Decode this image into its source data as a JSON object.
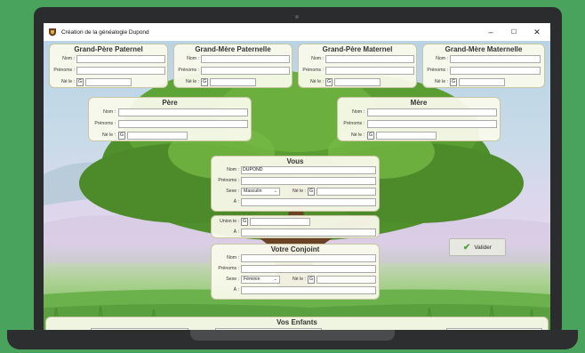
{
  "window": {
    "title": "Création de la généalogie Dupond",
    "controls": {
      "minimize": "–",
      "maximize": "☐",
      "close": "✕"
    }
  },
  "labels": {
    "nom": "Nom :",
    "prenoms": "Prénoms :",
    "nele": "Né le :",
    "sexe": "Sexe :",
    "a": "À :",
    "union": "Union le :",
    "calendar": "G"
  },
  "grandparents": [
    {
      "title": "Grand-Père Paternel",
      "nom": "",
      "prenoms": ""
    },
    {
      "title": "Grand-Mère Paternelle",
      "nom": "",
      "prenoms": ""
    },
    {
      "title": "Grand-Père Maternel",
      "nom": "",
      "prenoms": ""
    },
    {
      "title": "Grand-Mère Maternelle",
      "nom": "",
      "prenoms": ""
    }
  ],
  "parents": [
    {
      "title": "Père",
      "nom": "",
      "prenoms": ""
    },
    {
      "title": "Mère",
      "nom": "",
      "prenoms": ""
    }
  ],
  "vous": {
    "title": "Vous",
    "nom": "DUPOND",
    "prenoms": "",
    "sexe": "Masculin",
    "a": ""
  },
  "union": {
    "date": "",
    "a": ""
  },
  "conjoint": {
    "title": "Votre Conjoint",
    "nom": "",
    "prenoms": "",
    "sexe": "Féminin",
    "a": ""
  },
  "enfants": {
    "title": "Vos Enfants"
  },
  "valider_label": "Valider",
  "colors": {
    "background": "#4aa35c",
    "panel": "#fafaec",
    "accent_check": "#4aa63a"
  }
}
